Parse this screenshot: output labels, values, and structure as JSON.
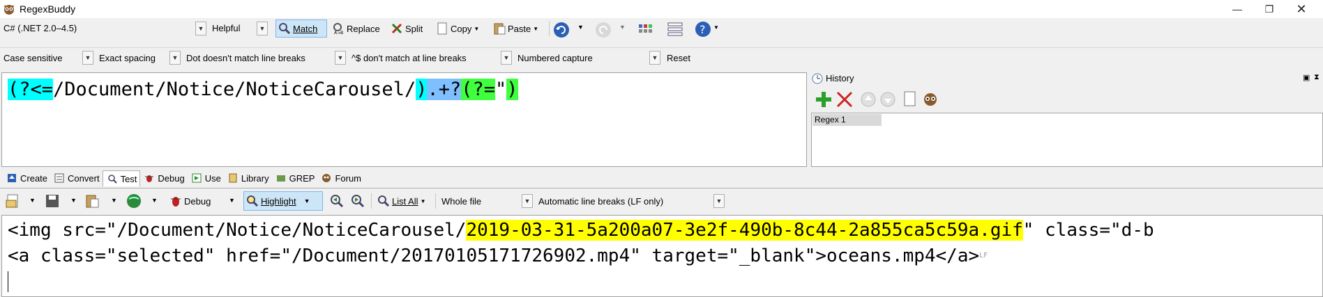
{
  "window": {
    "title": "RegexBuddy",
    "minimize_icon": "minimize-icon",
    "restore_icon": "restore-icon",
    "close_icon": "close-icon"
  },
  "toolbar1": {
    "flavor": "C# (.NET 2.0–4.5)",
    "helpful": "Helpful",
    "match": "Match",
    "replace": "Replace",
    "split": "Split",
    "copy": "Copy",
    "paste": "Paste"
  },
  "toolbar2": {
    "case": "Case sensitive",
    "spacing": "Exact spacing",
    "dot": "Dot doesn't match line breaks",
    "anchors": "^$ don't match at line breaks",
    "capture": "Numbered capture",
    "reset": "Reset"
  },
  "regex": {
    "tokens": [
      {
        "text": "(?<=",
        "color": "#00ffff"
      },
      {
        "text": "/Document/Notice/NoticeCarousel/",
        "color": "transparent"
      },
      {
        "text": ")",
        "color": "#00ffff"
      },
      {
        "text": ".+?",
        "color": "#7fbfff"
      },
      {
        "text": "(?=",
        "color": "#3fff3f"
      },
      {
        "text": "\"",
        "color": "transparent"
      },
      {
        "text": ")",
        "color": "#3fff3f"
      }
    ]
  },
  "history": {
    "title": "History",
    "items": [
      "Regex 1"
    ]
  },
  "tabs": [
    "Create",
    "Convert",
    "Test",
    "Debug",
    "Use",
    "Library",
    "GREP",
    "Forum"
  ],
  "test_toolbar": {
    "debug": "Debug",
    "highlight": "Highlight",
    "list_all": "List All",
    "scope": "Whole file",
    "line_breaks": "Automatic line breaks (LF only)"
  },
  "test": {
    "line1_pre": "<img src=\"/Document/Notice/NoticeCarousel/",
    "line1_match": "2019-03-31-5a200a07-3e2f-490b-8c44-2a855ca5c59a.gif",
    "line1_post": "\" class=\"d-b",
    "line2": "<a class=\"selected\" href=\"/Document/20170105171726902.mp4\" target=\"_blank\">oceans.mp4</a>",
    "line2_marker": "LF"
  }
}
